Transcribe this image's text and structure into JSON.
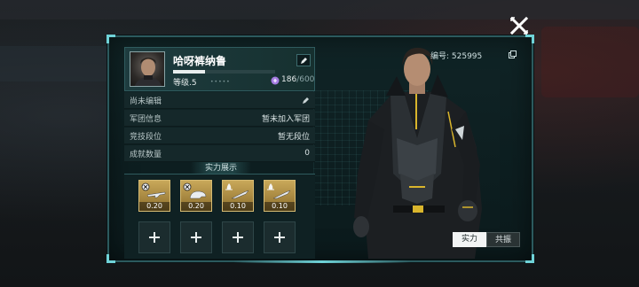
{
  "profile": {
    "name": "哈呀裤纳鲁",
    "level_label": "等级.5",
    "level_dots": "•••••",
    "xp_current": "186",
    "xp_max": "/600",
    "xp_fraction": 0.31,
    "id_text": "编号: 525995"
  },
  "info_rows": [
    {
      "label": "尚未编辑",
      "value": ""
    },
    {
      "label": "军团信息",
      "value": "暂未加入军团"
    },
    {
      "label": "竞技段位",
      "value": "暂无段位"
    },
    {
      "label": "成就数量",
      "value": "0"
    }
  ],
  "power": {
    "title": "实力展示",
    "filled_slots": [
      {
        "value": "0.20",
        "tag_icon": "crosshair-icon",
        "item_icon": "rifle-icon"
      },
      {
        "value": "0.20",
        "tag_icon": "crosshair-icon",
        "item_icon": "helmet-icon"
      },
      {
        "value": "0.10",
        "tag_icon": "flame-icon",
        "item_icon": "knife-icon"
      },
      {
        "value": "0.10",
        "tag_icon": "flame-icon",
        "item_icon": "knife-icon"
      }
    ],
    "empty_slot_icon": "plus-icon"
  },
  "tabs": [
    {
      "label": "实力",
      "active": true
    },
    {
      "label": "共振",
      "active": false
    }
  ],
  "colors": {
    "accent": "#6fd3d8",
    "panel_border": "#2c5a5e",
    "gold": "#c9a85a",
    "gem": "#a47be0"
  }
}
